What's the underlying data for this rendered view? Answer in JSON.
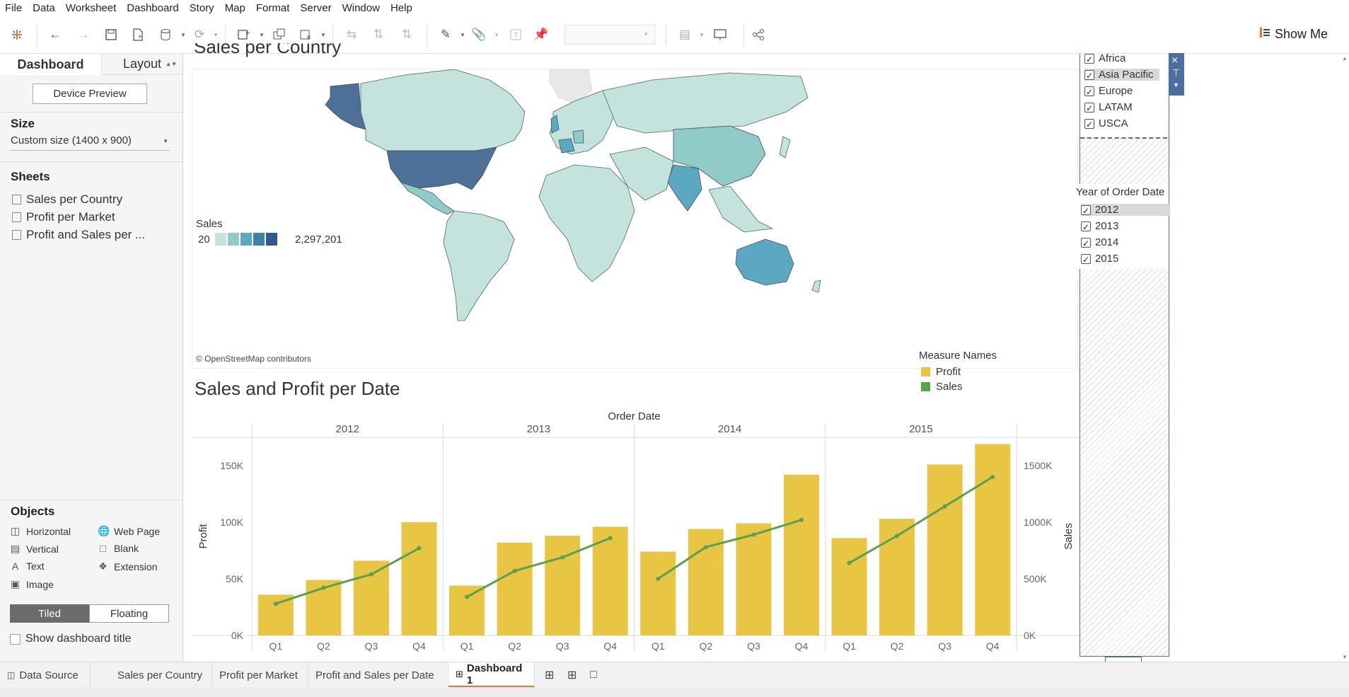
{
  "menu": [
    "File",
    "Data",
    "Worksheet",
    "Dashboard",
    "Story",
    "Map",
    "Format",
    "Server",
    "Window",
    "Help"
  ],
  "toolbar": {
    "show_me_label": "Show Me"
  },
  "left_panel": {
    "tab_dashboard": "Dashboard",
    "tab_layout": "Layout",
    "device_preview": "Device Preview",
    "size_title": "Size",
    "size_value": "Custom size (1400 x 900)",
    "sheets_title": "Sheets",
    "sheets": [
      "Sales per Country",
      "Profit per Market",
      "Profit and Sales per ..."
    ],
    "objects_title": "Objects",
    "objects": [
      {
        "label": "Horizontal",
        "icon": "horizontal-container-icon"
      },
      {
        "label": "Web Page",
        "icon": "globe-icon"
      },
      {
        "label": "Vertical",
        "icon": "vertical-container-icon"
      },
      {
        "label": "Blank",
        "icon": "blank-icon"
      },
      {
        "label": "Text",
        "icon": "text-icon"
      },
      {
        "label": "Extension",
        "icon": "puzzle-icon"
      },
      {
        "label": "Image",
        "icon": "image-icon"
      }
    ],
    "tiled_label": "Tiled",
    "floating_label": "Floating",
    "show_title_label": "Show dashboard title"
  },
  "dashboard": {
    "map_title": "Sales per Country",
    "map_credit": "© OpenStreetMap contributors",
    "legend_sales_title": "Sales",
    "legend_sales_min": "20",
    "legend_sales_max": "2,297,201",
    "legend_colors": [
      "#c4e3dd",
      "#90cbc8",
      "#5ca8c3",
      "#3c82aa",
      "#2d5b8c"
    ],
    "chart_title": "Sales and Profit per Date",
    "measure_names_title": "Measure Names",
    "measure_names": [
      {
        "label": "Profit",
        "color": "#e9c544"
      },
      {
        "label": "Sales",
        "color": "#59a14f"
      }
    ]
  },
  "filters": {
    "market_items": [
      "Africa",
      "Asia Pacific",
      "Europe",
      "LATAM",
      "USCA"
    ],
    "year_title": "Year of Order Date",
    "year_items": [
      "2012",
      "2013",
      "2014",
      "2015"
    ]
  },
  "chart_data": {
    "type": "bar",
    "title": "Sales and Profit per Date",
    "xlabel": "Order Date",
    "ylabel": "Profit",
    "y2label": "Sales",
    "years": [
      "2012",
      "2013",
      "2014",
      "2015"
    ],
    "quarters": [
      "Q1",
      "Q2",
      "Q3",
      "Q4"
    ],
    "ylim": [
      0,
      175000
    ],
    "y_ticks": [
      "0K",
      "50K",
      "100K",
      "150K"
    ],
    "y_tick_values": [
      0,
      50000,
      100000,
      150000
    ],
    "y2lim": [
      0,
      1750000
    ],
    "y2_ticks": [
      "0K",
      "500K",
      "1000K",
      "1500K"
    ],
    "y2_tick_values": [
      0,
      500000,
      1000000,
      1500000
    ],
    "series": [
      {
        "name": "Profit",
        "kind": "bar",
        "color": "#e9c544",
        "values": [
          36000,
          49000,
          66000,
          100000,
          44000,
          82000,
          88000,
          96000,
          74000,
          94000,
          99000,
          142000,
          86000,
          103000,
          151000,
          169000
        ]
      },
      {
        "name": "Sales",
        "kind": "line",
        "color": "#59a14f",
        "values": [
          280000,
          420000,
          540000,
          770000,
          340000,
          570000,
          690000,
          860000,
          500000,
          780000,
          890000,
          1020000,
          640000,
          880000,
          1140000,
          1400000
        ]
      }
    ]
  }
}
